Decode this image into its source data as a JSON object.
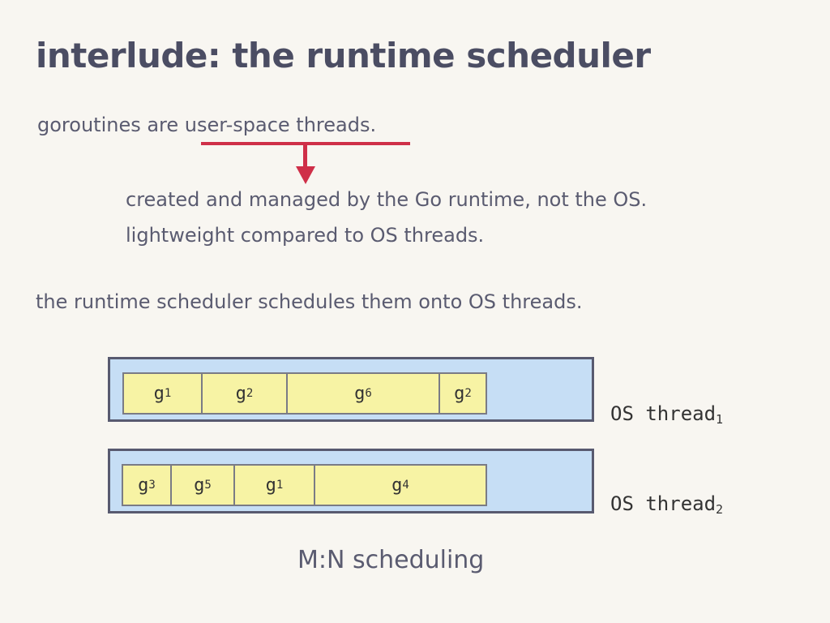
{
  "title": "interlude: the runtime scheduler",
  "text": {
    "line1": "goroutines are user-space threads.",
    "line2": "created and managed by the Go runtime, not the OS.",
    "line3": "lightweight compared to OS threads.",
    "line4": "the runtime scheduler schedules them onto OS threads."
  },
  "colors": {
    "accent": "#cf2f48",
    "thread_fill": "#c6def5",
    "goroutine_fill": "#f7f3a4"
  },
  "threads": [
    {
      "label": "OS thread",
      "sub": "1",
      "goroutines": [
        {
          "name": "g",
          "sub": "1"
        },
        {
          "name": "g",
          "sub": "2"
        },
        {
          "name": "g",
          "sub": "6"
        },
        {
          "name": "g",
          "sub": "2"
        }
      ]
    },
    {
      "label": "OS thread",
      "sub": "2",
      "goroutines": [
        {
          "name": "g",
          "sub": "3"
        },
        {
          "name": "g",
          "sub": "5"
        },
        {
          "name": "g",
          "sub": "1"
        },
        {
          "name": "g",
          "sub": "4"
        }
      ]
    }
  ],
  "caption": "M:N scheduling"
}
